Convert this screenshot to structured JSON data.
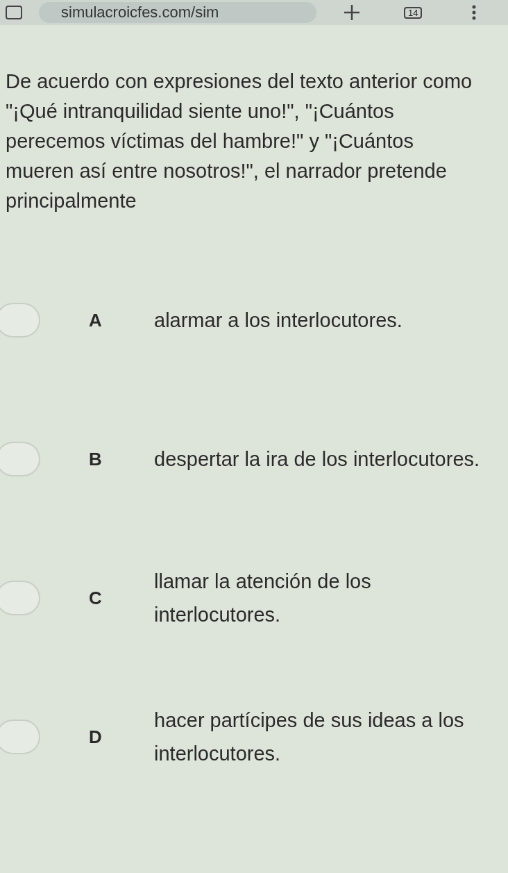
{
  "browser_bar": {
    "url": "simulacroicfes.com/sim",
    "tab_count": "14"
  },
  "question": "De acuerdo con expresiones del texto anterior como \"¡Qué intranquilidad siente uno!\", \"¡Cuántos perecemos víctimas del hambre!\" y \"¡Cuántos mueren así entre nosotros!\", el narrador pretende principalmente",
  "options": [
    {
      "letter": "A",
      "text": "alarmar a los interlocutores.",
      "selected": false
    },
    {
      "letter": "B",
      "text": "despertar la ira de los interlocutores.",
      "selected": false
    },
    {
      "letter": "C",
      "text": "llamar la atención de los interlocutores.",
      "selected": false
    },
    {
      "letter": "D",
      "text": "hacer partícipes de sus ideas a los interlocutores.",
      "selected": false
    }
  ]
}
